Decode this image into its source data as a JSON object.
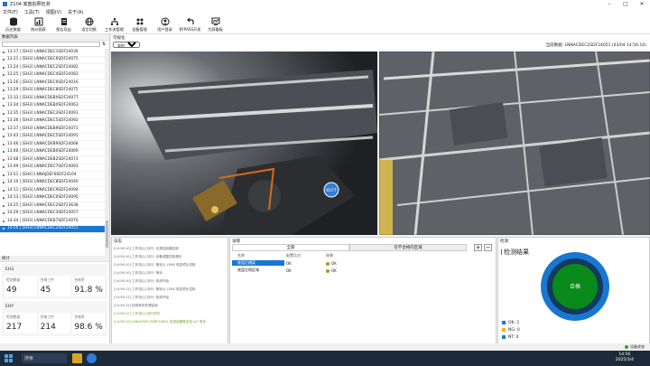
{
  "window": {
    "title": "Z104 底盘拍照检测",
    "min": "–",
    "max": "□",
    "close": "✕"
  },
  "menu": [
    "文件(F)",
    "工具(T)",
    "视图(V)",
    "关于(A)"
  ],
  "toolbar": [
    {
      "label": "历史数据",
      "icon": "database-icon"
    },
    {
      "label": "统计图表",
      "icon": "chart-icon"
    },
    {
      "label": "报告导出",
      "icon": "report-icon"
    },
    {
      "label": "语言切换",
      "icon": "globe-icon"
    },
    {
      "label": "工作流管理",
      "icon": "workflow-icon"
    },
    {
      "label": "设备管理",
      "icon": "device-icon"
    },
    {
      "label": "用户登录",
      "icon": "user-icon"
    },
    {
      "label": "BYPASS开发",
      "icon": "bypass-icon"
    },
    {
      "label": "大屏看板",
      "icon": "dashboard-icon"
    }
  ],
  "records": {
    "title": "数据列表",
    "search_placeholder": "",
    "items": [
      {
        "text": "13:17 | [EH3] LNNACDEC1SDF24039",
        "color": "#8b2e2e"
      },
      {
        "text": "13:21 | [EH3] LNNACDEC6SDF24075",
        "color": "#8b2e2e"
      },
      {
        "text": "13:24 | [EH3] LNNACDEC2SDF24082",
        "color": "#8b2e2e"
      },
      {
        "text": "13:25 | [EH3] LNNACDEC4SDF24083",
        "color": "#8b2e2e"
      },
      {
        "text": "13:26 | [EH3] LNNACDEC0SDF24016",
        "color": "#8b2e2e"
      },
      {
        "text": "13:29 | [EH3] LNNACDEC8SDF24075",
        "color": "#8b2e2e"
      },
      {
        "text": "13:33 | [EH3] LNNACDEBXSDF24077",
        "color": "#8b2e2e"
      },
      {
        "text": "13:34 | [EH3] LNNACDEBXSDF24063",
        "color": "#8b2e2e"
      },
      {
        "text": "13:35 | [EH3] LNNACDEC3SDF24091",
        "color": "#8b2e2e"
      },
      {
        "text": "13:36 | [EH3] LNNACDEC5SDF24092",
        "color": "#8b2e2e"
      },
      {
        "text": "13:37 | [EH3] LNNACDEB9SDF24071",
        "color": "#8b2e2e"
      },
      {
        "text": "13:43 | [EH3] LNNACDEC5SDF24091",
        "color": "#8b2e2e"
      },
      {
        "text": "13:46 | [EH3] LNNACDEB9SDF24068",
        "color": "#cc2222"
      },
      {
        "text": "13:46 | [EH3] LNNACDEB0SDF24069",
        "color": "#8b2e2e"
      },
      {
        "text": "13:48 | [EH3] LNNACDEB2SDF24073",
        "color": "#8b2e2e"
      },
      {
        "text": "13:49 | [EH3] LNNACDEC7SDF24093",
        "color": "#8b2e2e"
      },
      {
        "text": "13:51 | [EHX] LNNAJDEF6SDF24104",
        "color": "#8b2e2e"
      },
      {
        "text": "14:10 | [EH3] LNNACDEC8SDF24040",
        "color": "#8b2e2e"
      },
      {
        "text": "14:11 | [EH3] LNNACDEC9SDF24094",
        "color": "#8b2e2e"
      },
      {
        "text": "14:13 | [EH3] LNNACDEC0SDF24095",
        "color": "#8b2e2e"
      },
      {
        "text": "14:25 | [EH3] LNNACDEC2SDF23638",
        "color": "#8b2e2e"
      },
      {
        "text": "14:29 | [EH3] LNNACDEC3SDF24057",
        "color": "#8b2e2e"
      },
      {
        "text": "14:34 | [EH3] LNNACDEB7SDF24070",
        "color": "#8b2e2e"
      },
      {
        "text": "14:56 | [EH3] LNNACDEC2SDF24051",
        "color": "#ffffff",
        "selected": true
      }
    ]
  },
  "stats": {
    "title": "统计",
    "groups": [
      {
        "name": "EH3",
        "labels": [
          "检测数量",
          "合格工件",
          "合格率"
        ],
        "values": [
          "49",
          "45",
          "91.8 %"
        ]
      },
      {
        "name": "EHY",
        "labels": [
          "检测数量",
          "合格工件",
          "合格率"
        ],
        "values": [
          "217",
          "214",
          "98.6 %"
        ]
      }
    ]
  },
  "viz": {
    "title": "可视化",
    "mode": "实时",
    "current": "当前数据: LNNACDEC2SDF24051 (03/04 14:56:10)",
    "marker": "6577"
  },
  "log": {
    "title": "日志",
    "lines": [
      {
        "text": "[14:56:10] 工作流[1] 执行: 光源控制器控制"
      },
      {
        "text": "[14:56:10] 工作流[1] 执行: 设备调整控制漏光"
      },
      {
        "text": "[14:56:10] 工作流[1] 执行: 撕标认 LENS 电控镜头控制"
      },
      {
        "text": "[14:56:10] 工作流[1] 执行: 等待"
      },
      {
        "text": "[14:56:10] 工作流[1] 执行: 检测开始"
      },
      {
        "text": "[14:56:11] 工作流[1] 执行: 撕标认 LENS 电控镜头控制"
      },
      {
        "text": "[14:56:11] 工作流[1] 执行: 检测开始"
      },
      {
        "text": "[14:56:12] 检测耗时处理结束"
      },
      {
        "text": "[14:56:12] 工作流[1] 执行完毕",
        "ok": true
      },
      {
        "text": "[14:56:12] LNNACDEC2SDF24051 检测结果推送至 IoT 成功",
        "ok": true
      }
    ]
  },
  "detail": {
    "title": "详情",
    "tabs": [
      "全部",
      "仅不合格的区域"
    ],
    "plus": "+",
    "minus": "−",
    "headers": [
      "名称",
      "配置比对",
      "结果"
    ],
    "rows": [
      {
        "name": "底盘后横梁",
        "cmp": "OK",
        "res": "OK",
        "selected": true
      },
      {
        "name": "底盘左侧区域",
        "cmp": "OK",
        "res": "OK"
      }
    ]
  },
  "result": {
    "panel": "检测",
    "title": "检测结果",
    "center": "合格",
    "ok": 1,
    "ng": 0,
    "nt": 0,
    "legend": [
      {
        "label": "OK:",
        "value": "1",
        "color": "#1976d2"
      },
      {
        "label": "NG:",
        "value": "0",
        "color": "#f4b400"
      },
      {
        "label": "NT:",
        "value": "0",
        "color": "#2a7ab0"
      }
    ]
  },
  "statusbar": {
    "text": "设备状态"
  },
  "taskbar": {
    "time": "14:56",
    "date": "2025/3/4",
    "search": "搜索"
  }
}
